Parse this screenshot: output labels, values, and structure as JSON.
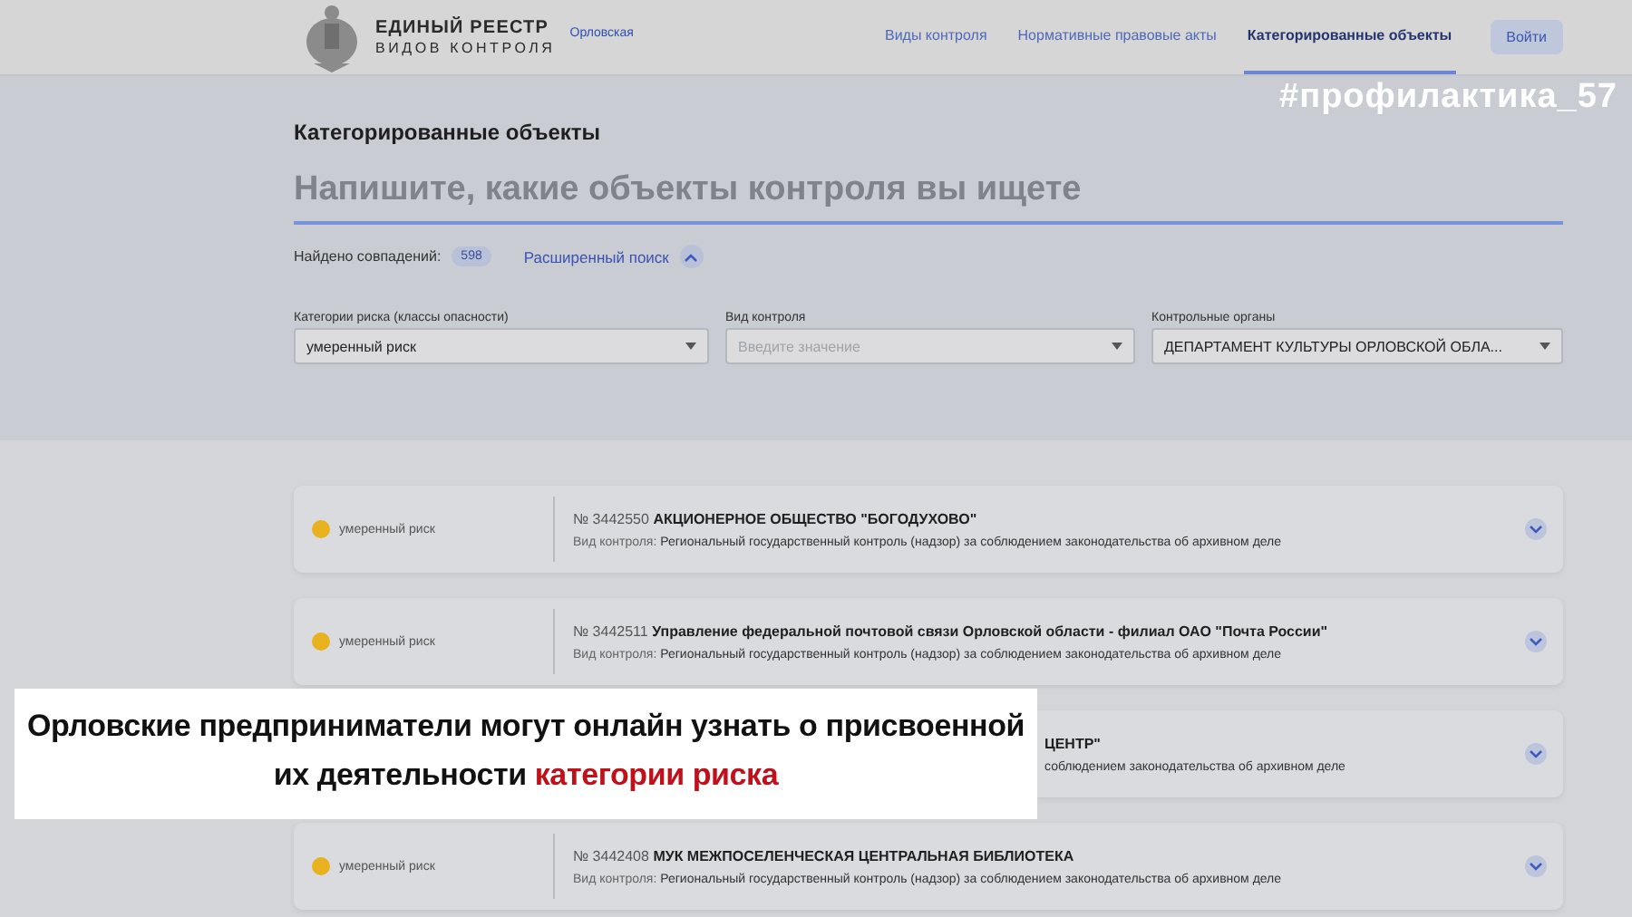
{
  "header": {
    "logo_line_1": "ЕДИНЫЙ РЕЕСТР",
    "logo_line_2": "ВИДОВ КОНТРОЛЯ",
    "region": "Орловская",
    "nav": [
      {
        "label": "Виды контроля",
        "selected": false
      },
      {
        "label": "Нормативные правовые акты",
        "selected": false
      },
      {
        "label": "Категорированные объекты",
        "selected": true
      }
    ],
    "login_button": "Войти"
  },
  "overlay_hashtag": "#профилактика_57",
  "search": {
    "title": "Категорированные объекты",
    "placeholder": "Напишите, какие объекты контроля вы ищете",
    "found_label": "Найдено совпадений:",
    "found_count": "598",
    "advanced_link": "Расширенный поиск",
    "advanced_expanded": true
  },
  "filters": [
    {
      "label": "Категории риска (классы опасности)",
      "value": "умеренный риск"
    },
    {
      "label": "Вид контроля",
      "placeholder": "Введите значение"
    },
    {
      "label": "Контрольные органы",
      "value": "ДЕПАРТАМЕНТ КУЛЬТУРЫ ОРЛОВСКОЙ ОБЛА..."
    }
  ],
  "results": [
    {
      "kind": "full",
      "risk": "умеренный риск",
      "color": "#e8b21f",
      "number": "№ 3442550",
      "name": "АКЦИОНЕРНОЕ ОБЩЕСТВО \"БОГОДУХОВО\"",
      "control_label": "Вид контроля:",
      "control": "Региональный государственный контроль (надзор) за соблюдением законодательства об архивном деле"
    },
    {
      "kind": "full",
      "risk": "умеренный риск",
      "color": "#e8b21f",
      "number": "№ 3442511",
      "name": "Управление федеральной почтовой связи Орловской области - филиал ОАО \"Почта России\"",
      "control_label": "Вид контроля:",
      "control": "Региональный государственный контроль (надзор) за соблюдением законодательства об архивном деле"
    },
    {
      "kind": "covered",
      "name": "ЦЕНТР\"",
      "control": "соблюдением законодательства об архивном деле"
    },
    {
      "kind": "full",
      "risk": "умеренный риск",
      "color": "#e8b21f",
      "number": "№ 3442408",
      "name": "МУК МЕЖПОСЕЛЕНЧЕСКАЯ ЦЕНТРАЛЬНАЯ БИБЛИОТЕКА",
      "control_label": "Вид контроля:",
      "control": "Региональный государственный контроль (надзор) за соблюдением законодательства об архивном деле"
    }
  ],
  "caption": {
    "text": "Орловские предприниматели могут онлайн узнать о присвоенной их деятельности **категории риска**"
  }
}
